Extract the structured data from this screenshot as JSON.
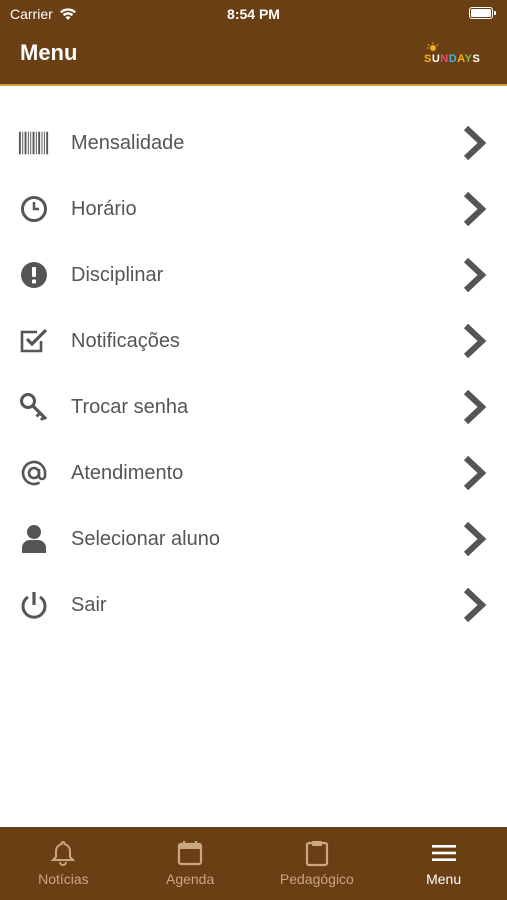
{
  "status_bar": {
    "carrier": "Carrier",
    "time": "8:54 PM"
  },
  "header": {
    "title": "Menu",
    "logo_text": "SUNDAYS"
  },
  "menu": {
    "items": [
      {
        "label": "Mensalidade",
        "icon": "barcode-icon"
      },
      {
        "label": "Horário",
        "icon": "clock-icon"
      },
      {
        "label": "Disciplinar",
        "icon": "exclamation-icon"
      },
      {
        "label": "Notificações",
        "icon": "checkbox-icon"
      },
      {
        "label": "Trocar senha",
        "icon": "key-icon"
      },
      {
        "label": "Atendimento",
        "icon": "at-icon"
      },
      {
        "label": "Selecionar aluno",
        "icon": "user-icon"
      },
      {
        "label": "Sair",
        "icon": "power-icon"
      }
    ]
  },
  "tab_bar": {
    "tabs": [
      {
        "label": "Notícias",
        "icon": "bell-icon",
        "active": false
      },
      {
        "label": "Agenda",
        "icon": "calendar-icon",
        "active": false
      },
      {
        "label": "Pedagógico",
        "icon": "clipboard-icon",
        "active": false
      },
      {
        "label": "Menu",
        "icon": "hamburger-icon",
        "active": true
      }
    ]
  },
  "colors": {
    "brand_brown": "#6b3f14",
    "accent_gold": "#c9a13b",
    "text_gray": "#555555",
    "icon_gray": "#4a4a4a"
  }
}
